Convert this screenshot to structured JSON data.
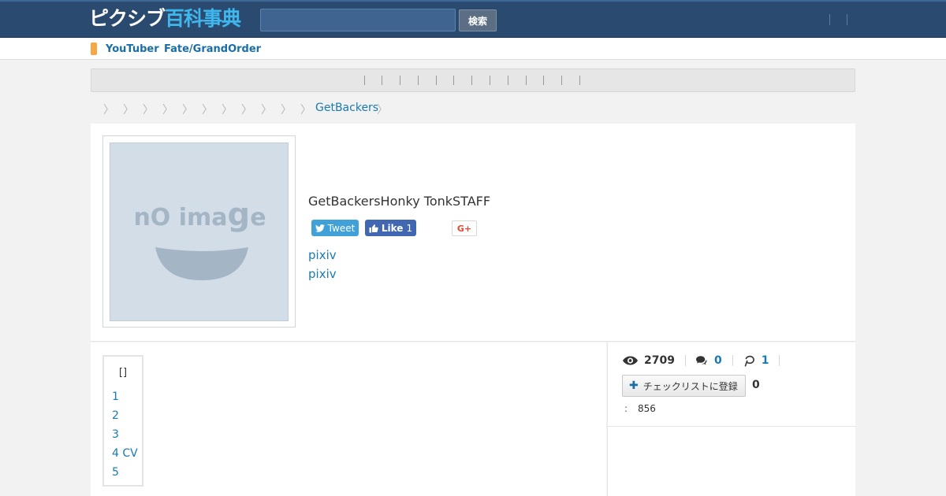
{
  "header": {
    "logo_part1": "ピクシブ",
    "logo_part2": "百科事典",
    "search_placeholder": "",
    "search_button": "検索"
  },
  "tagbar": {
    "tags": [
      "YouTuber",
      "Fate/GrandOrder"
    ],
    "marker_color": "#f6a746"
  },
  "breadcrumb": {
    "separator": "〉",
    "current": "GetBackers"
  },
  "article": {
    "image_placeholder": {
      "text_left": "nO ima",
      "text_right": "e",
      "glyph": "g"
    },
    "title": "GetBackersHonky TonkSTAFF",
    "share": {
      "tweet": "Tweet",
      "like": "Like",
      "like_count": "1",
      "gplus": "G+"
    },
    "links": [
      "pixiv",
      "pixiv"
    ]
  },
  "toc": {
    "title": "[]",
    "items": [
      "1",
      "2",
      "3",
      "4 CV",
      "5"
    ]
  },
  "stats": {
    "views": "2709",
    "comments": "0",
    "pins": "1",
    "checklist_button": "チェックリストに登録",
    "checklist_count": "0",
    "misc_label": ":",
    "misc_value": "856"
  },
  "colors": {
    "header_bg": "#2b4a6f",
    "link": "#1a7ab0",
    "accent_blue": "#3fb7ec"
  }
}
